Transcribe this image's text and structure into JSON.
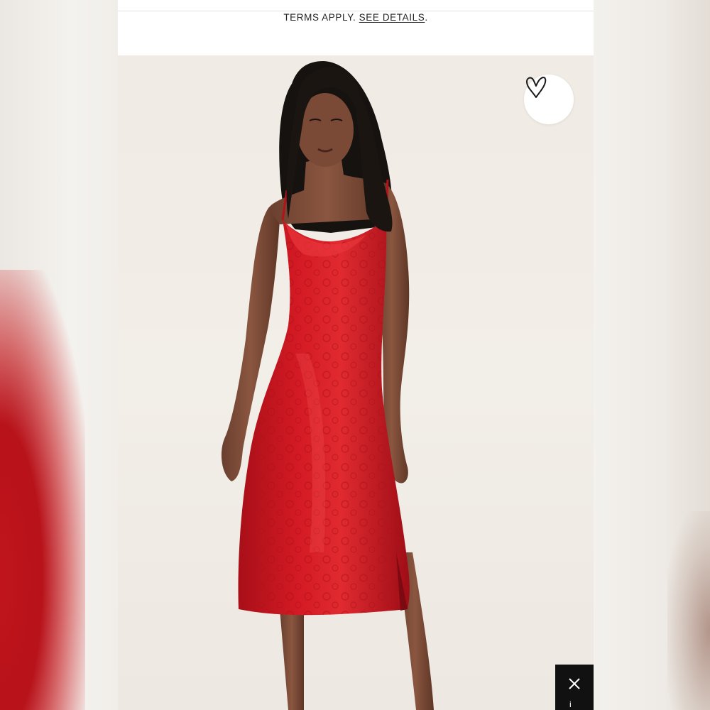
{
  "promo": {
    "text": "TERMS APPLY.",
    "link": "SEE DETAILS",
    "suffix": "."
  },
  "product_image": {
    "subject": "red satin jacquard cowl neck midi slip dress"
  },
  "wishlist": {
    "icon": "heart-icon"
  },
  "chat_tab": {
    "icon": "close-icon",
    "partial_text": "i"
  },
  "colors": {
    "dress_red": "#c8141e",
    "background": "#f0ebe4"
  }
}
